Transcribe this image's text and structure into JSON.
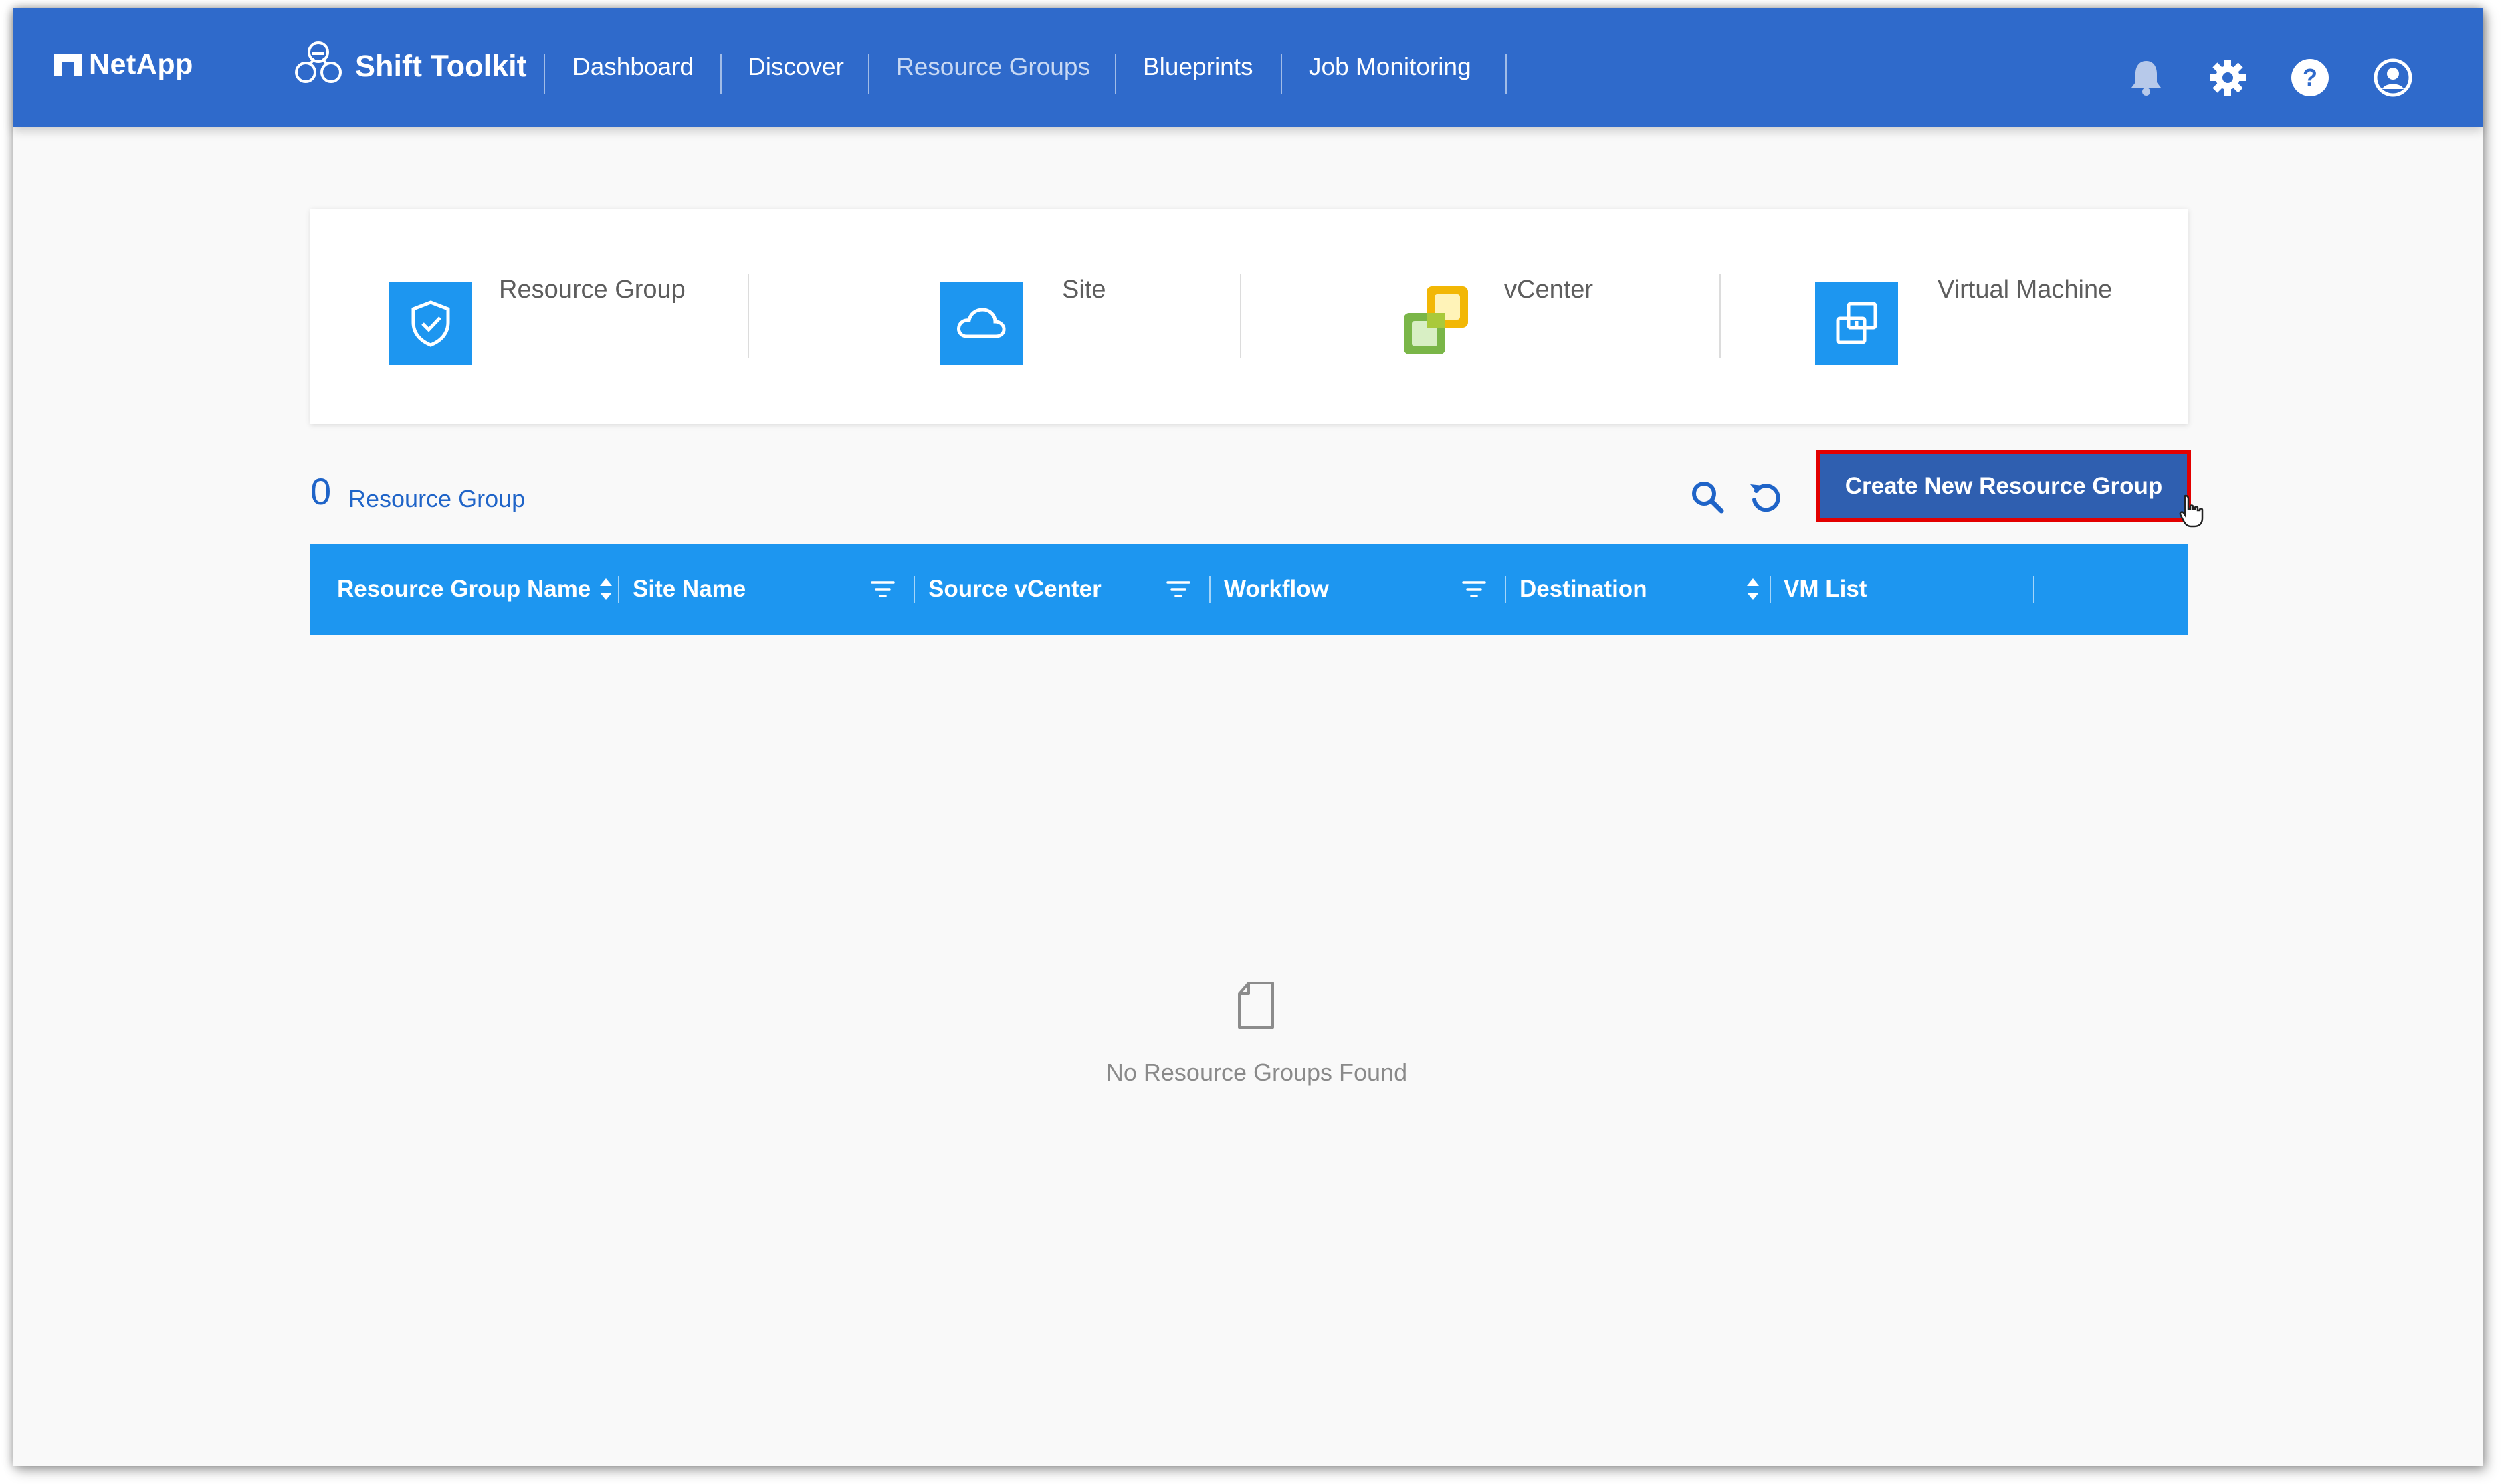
{
  "header": {
    "brand": "NetApp",
    "app_name": "Shift Toolkit",
    "nav": [
      {
        "label": "Dashboard",
        "active": false
      },
      {
        "label": "Discover",
        "active": false
      },
      {
        "label": "Resource Groups",
        "active": true
      },
      {
        "label": "Blueprints",
        "active": false
      },
      {
        "label": "Job Monitoring",
        "active": false
      }
    ],
    "icons": [
      "bell-icon",
      "gear-icon",
      "help-icon",
      "user-icon"
    ]
  },
  "summary": {
    "tiles": [
      {
        "label": "Resource Group",
        "icon": "shield-check-icon"
      },
      {
        "label": "Site",
        "icon": "cloud-icon"
      },
      {
        "label": "vCenter",
        "icon": "vcenter-icon"
      },
      {
        "label": "Virtual Machine",
        "icon": "virtual-machine-icon"
      }
    ]
  },
  "list": {
    "count": "0",
    "count_label": "Resource Group",
    "create_button": "Create New Resource Group",
    "columns": [
      {
        "label": "Resource Group Name",
        "control": "sort"
      },
      {
        "label": "Site Name",
        "control": "filter"
      },
      {
        "label": "Source vCenter",
        "control": "filter"
      },
      {
        "label": "Workflow",
        "control": "filter"
      },
      {
        "label": "Destination",
        "control": "sort"
      },
      {
        "label": "VM List",
        "control": "none"
      }
    ],
    "empty_text": "No Resource Groups Found"
  },
  "colors": {
    "topbar": "#2f6acb",
    "accent": "#1d96f0",
    "button": "#2f5fb0",
    "highlight": "#e30000"
  }
}
